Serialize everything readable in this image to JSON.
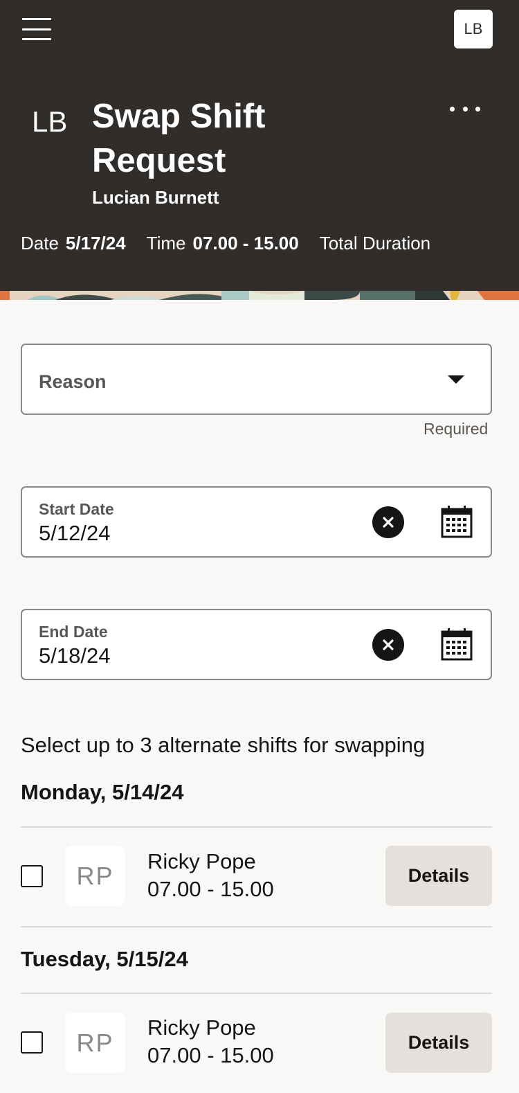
{
  "header": {
    "user_badge": "LB",
    "initials": "LB",
    "title": "Swap Shift Request",
    "subtitle": "Lucian Burnett",
    "date_label": "Date",
    "date_value": "5/17/24",
    "time_label": "Time",
    "time_value": "07.00 - 15.00",
    "duration_label": "Total Duration"
  },
  "form": {
    "reason_placeholder": "Reason",
    "reason_helper": "Required",
    "start_date": {
      "label": "Start Date",
      "value": "5/12/24"
    },
    "end_date": {
      "label": "End Date",
      "value": "5/18/24"
    }
  },
  "shifts": {
    "instructions": "Select up to 3 alternate shifts for swapping",
    "groups": [
      {
        "day": "Monday, 5/14/24",
        "items": [
          {
            "initials": "RP",
            "name": "Ricky Pope",
            "time": "07.00 - 15.00",
            "action": "Details",
            "checked": false
          }
        ]
      },
      {
        "day": "Tuesday, 5/15/24",
        "items": [
          {
            "initials": "RP",
            "name": "Ricky Pope",
            "time": "07.00 - 15.00",
            "action": "Details",
            "checked": false
          }
        ]
      }
    ]
  },
  "icons": {
    "menu": "hamburger-menu-icon",
    "more": "more-options-icon",
    "dropdown": "chevron-down-icon",
    "clear": "clear-icon",
    "calendar": "calendar-icon"
  },
  "colors": {
    "header_bg": "#312d2a",
    "page_bg": "#f9f8f6",
    "button_bg": "#e4e1dd"
  }
}
